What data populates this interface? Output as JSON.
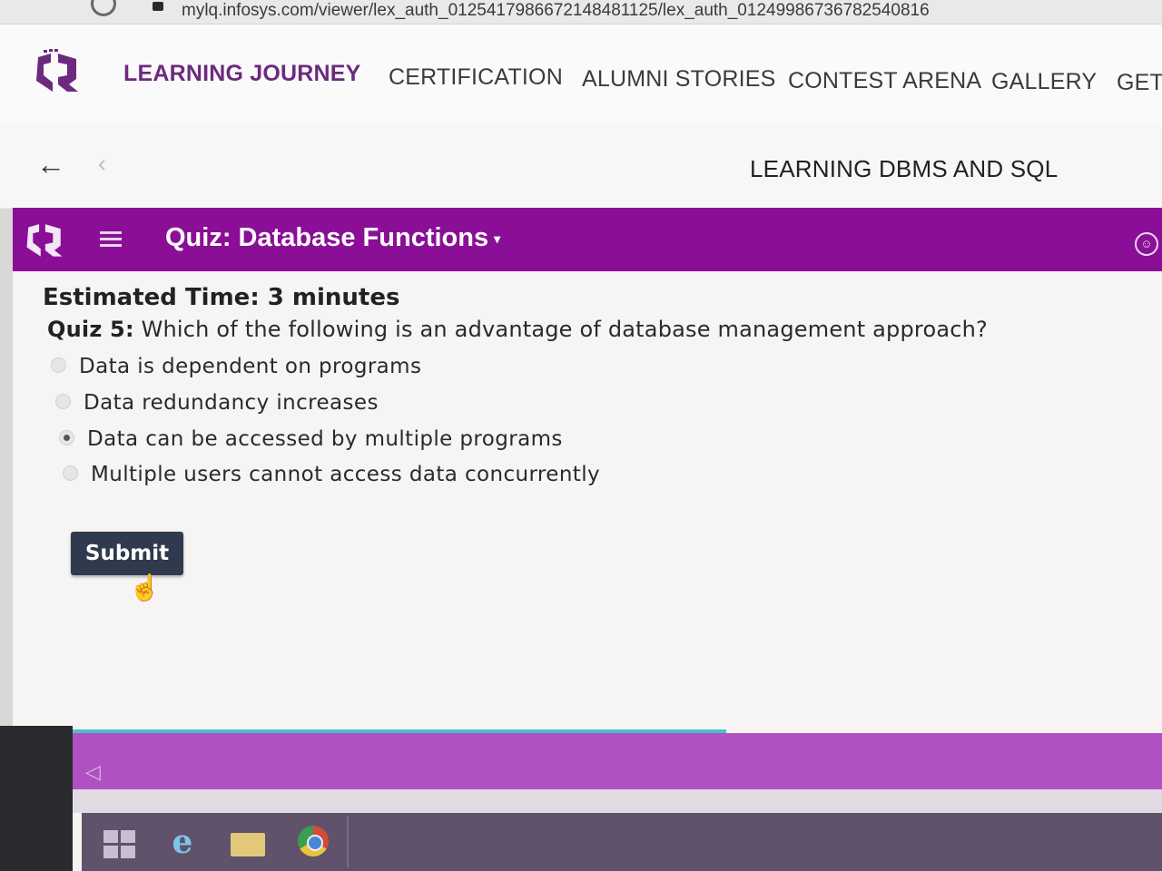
{
  "browser": {
    "url": "mylq.infosys.com/viewer/lex_auth_01254179866721484811​25/lex_auth_01249986736782540816"
  },
  "topnav": {
    "items": [
      {
        "label": "LEARNING JOURNEY"
      },
      {
        "label": "CERTIFICATION"
      },
      {
        "label": "ALUMNI STORIES"
      },
      {
        "label": "CONTEST ARENA"
      },
      {
        "label": "GALLERY"
      },
      {
        "label": "GET"
      }
    ]
  },
  "breadcrumb": {
    "course_title": "LEARNING DBMS AND SQL"
  },
  "quiz_bar": {
    "title": "Quiz: Database Functions",
    "caret": "▾",
    "accent_color": "#8a0f96"
  },
  "quiz": {
    "estimated_time": "Estimated Time: 3 minutes",
    "question_number": "Quiz 5:",
    "question_text": " Which of the following is an advantage of database management approach?",
    "options": [
      {
        "label": "Data is dependent on programs",
        "selected": false
      },
      {
        "label": "Data redundancy increases",
        "selected": false
      },
      {
        "label": "Data can be accessed by multiple programs",
        "selected": true
      },
      {
        "label": "Multiple users cannot access data concurrently",
        "selected": false
      }
    ],
    "submit_label": "Submit"
  },
  "bottom_nav": {
    "prev_symbol": "◁",
    "progress": 0.6
  },
  "icons": {
    "back": "arrow-left-icon",
    "chevron": "chevron-left-icon",
    "menu": "hamburger-icon",
    "feedback": "smiley-icon"
  }
}
